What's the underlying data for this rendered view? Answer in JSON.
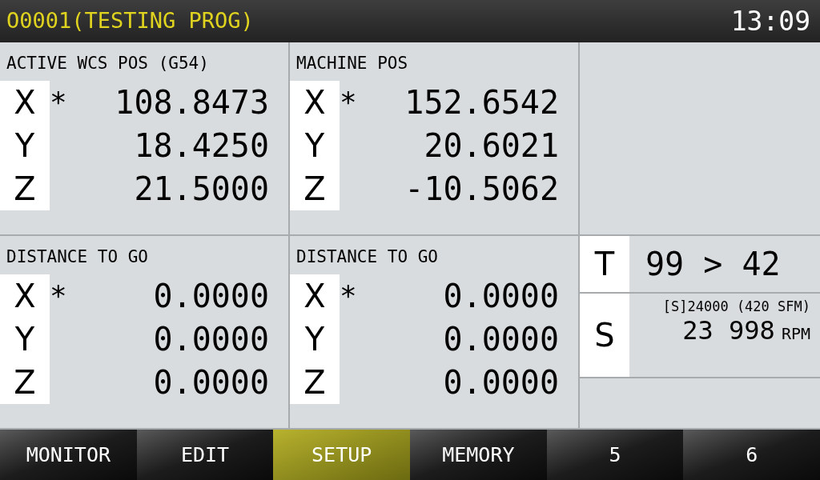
{
  "header": {
    "program": "O0001(TESTING PROG)",
    "time": "13:09"
  },
  "panels": [
    {
      "title": "ACTIVE WCS POS (G54)",
      "axes": [
        {
          "axis": "X",
          "mark": "*",
          "value": "108.8473"
        },
        {
          "axis": "Y",
          "value": "18.4250"
        },
        {
          "axis": "Z",
          "value": "21.5000"
        }
      ]
    },
    {
      "title": "MACHINE POS",
      "axes": [
        {
          "axis": "X",
          "mark": "*",
          "value": "152.6542"
        },
        {
          "axis": "Y",
          "value": "20.6021"
        },
        {
          "axis": "Z",
          "value": "-10.5062"
        }
      ]
    },
    {
      "title": "DISTANCE TO GO",
      "axes": [
        {
          "axis": "X",
          "mark": "*",
          "value": "0.0000"
        },
        {
          "axis": "Y",
          "value": "0.0000"
        },
        {
          "axis": "Z",
          "value": "0.0000"
        }
      ]
    },
    {
      "title": "DISTANCE TO GO",
      "axes": [
        {
          "axis": "X",
          "mark": "*",
          "value": "0.0000"
        },
        {
          "axis": "Y",
          "value": "0.0000"
        },
        {
          "axis": "Z",
          "value": "0.0000"
        }
      ]
    }
  ],
  "tool": {
    "label": "T",
    "value": "99 > 42"
  },
  "spindle": {
    "label": "S",
    "command": "[S]24000 (420 SFM)",
    "speed": "23 998",
    "unit": "RPM"
  },
  "softkeys": [
    {
      "label": "MONITOR",
      "selected": false
    },
    {
      "label": "EDIT",
      "selected": false
    },
    {
      "label": "SETUP",
      "selected": true
    },
    {
      "label": "MEMORY",
      "selected": false
    },
    {
      "label": "5",
      "selected": false
    },
    {
      "label": "6",
      "selected": false
    }
  ]
}
